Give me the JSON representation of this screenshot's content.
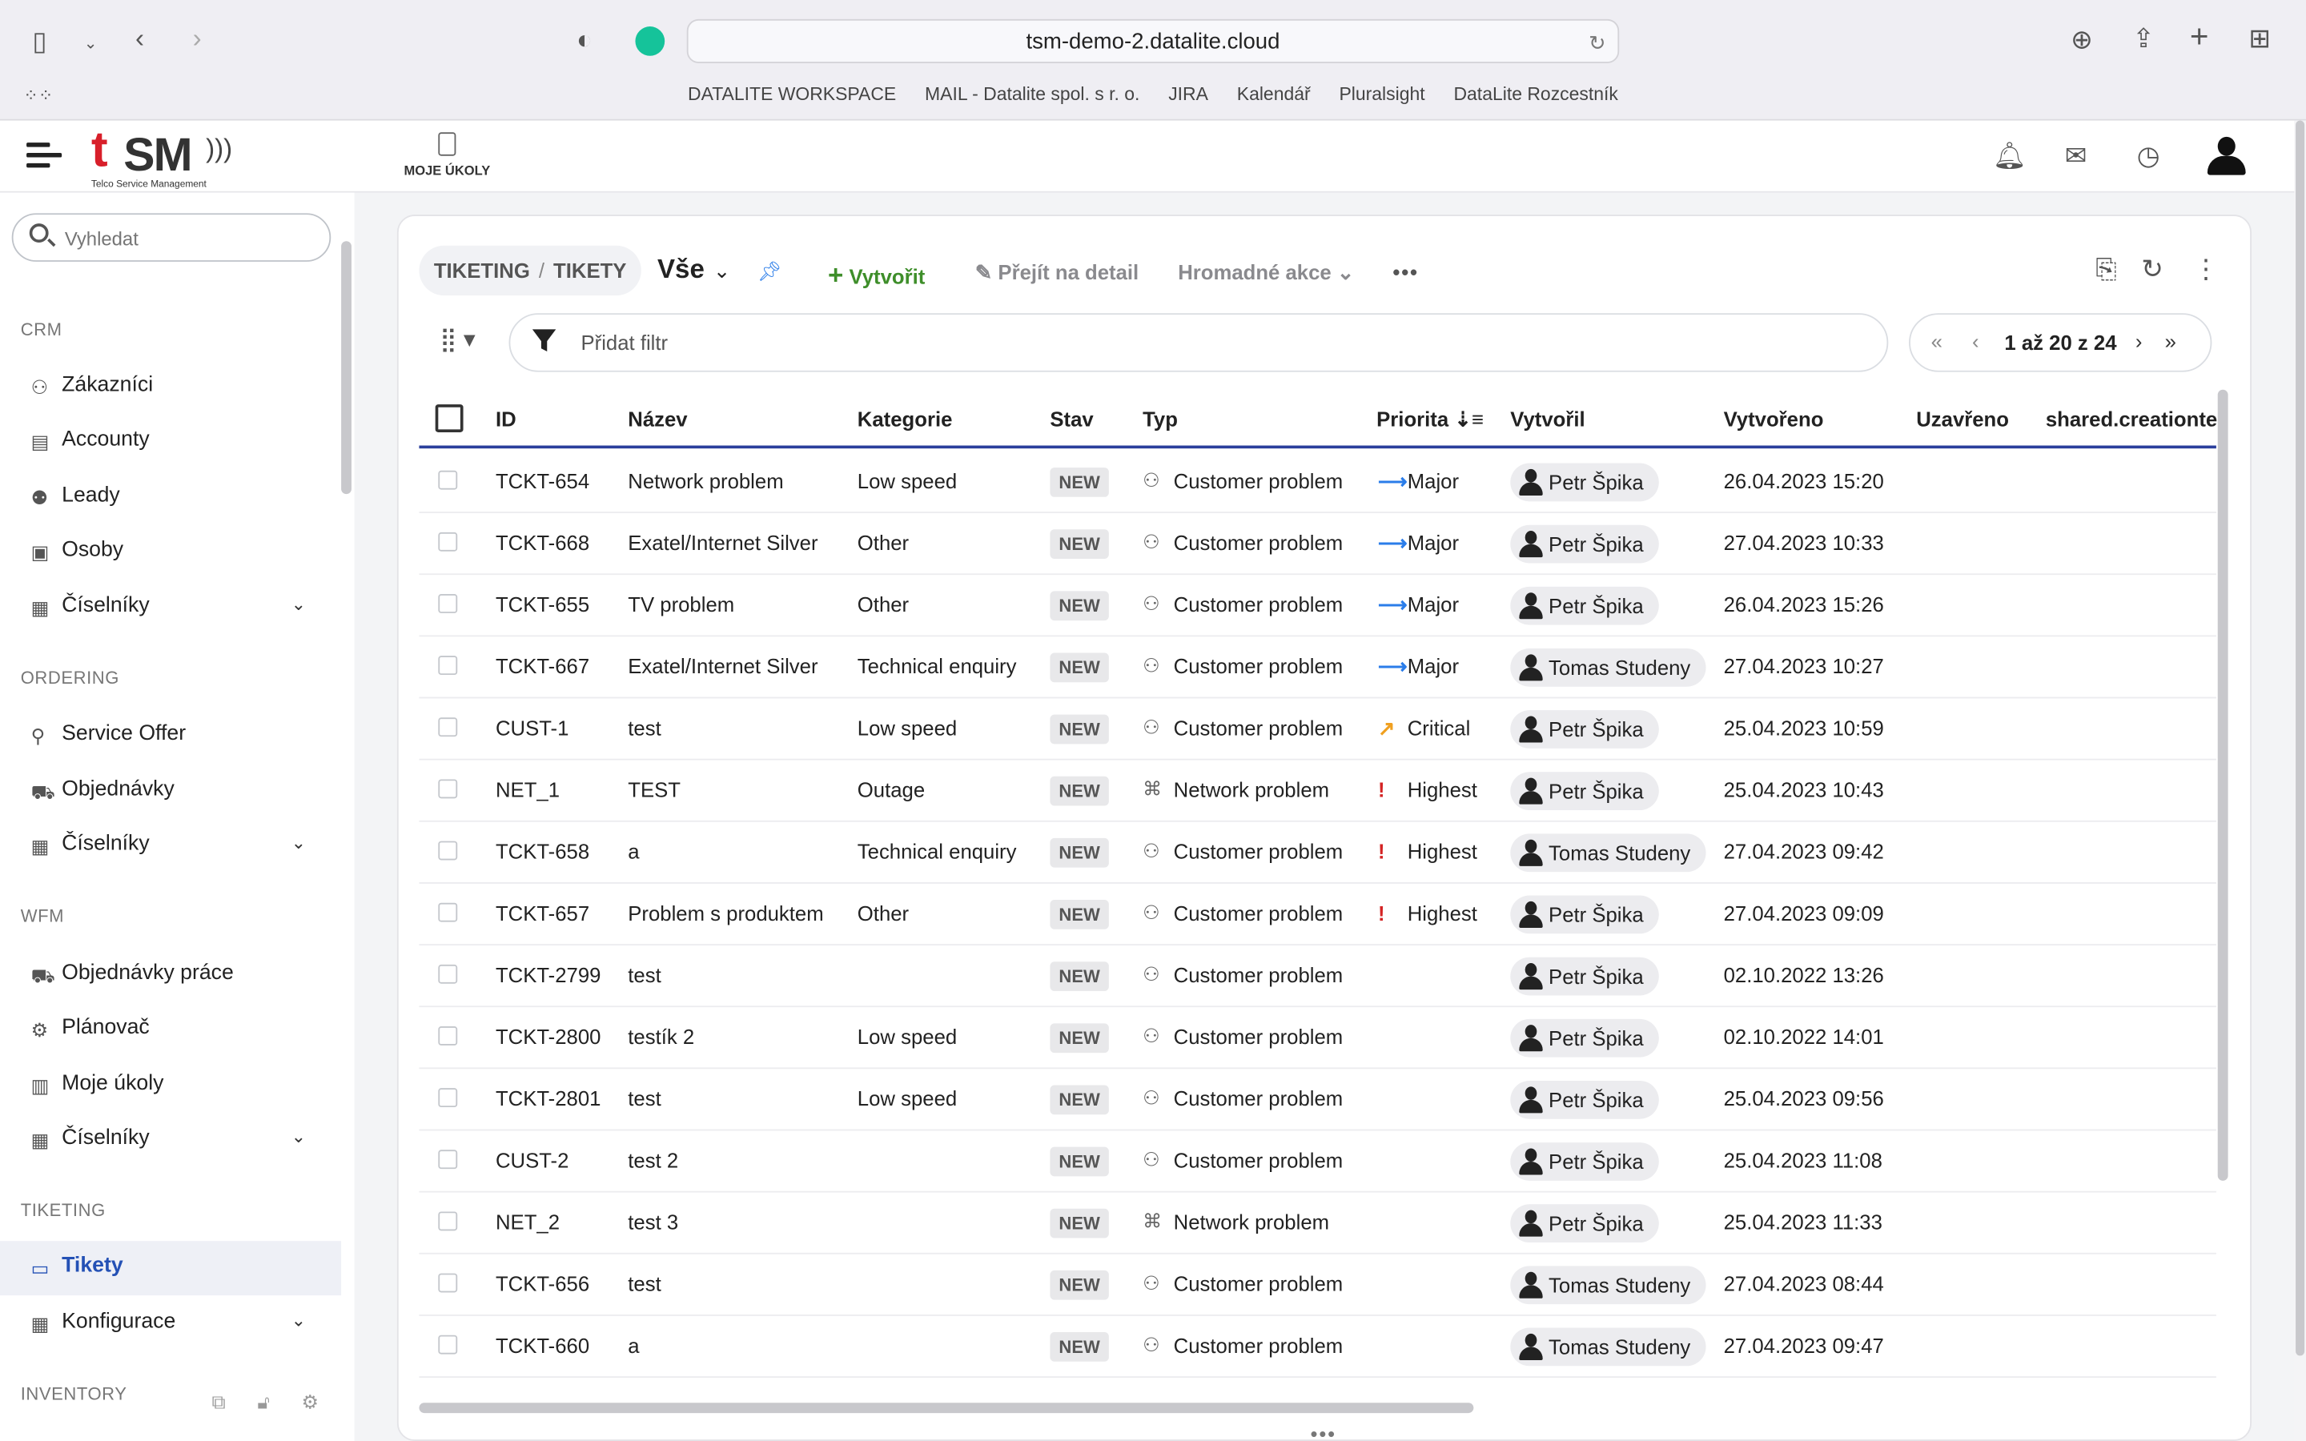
{
  "browser": {
    "url": "tsm-demo-2.datalite.cloud",
    "bookmarks": [
      "DATALITE WORKSPACE",
      "MAIL - Datalite spol. s r. o.",
      "JIRA",
      "Kalendář",
      "Pluralsight",
      "DataLite Rozcestník"
    ]
  },
  "header": {
    "logo_text": "tSM",
    "logo_sub": "Telco Service Management",
    "my_tasks": "MOJE ÚKOLY"
  },
  "sidebar": {
    "search_placeholder": "Vyhledat",
    "sections": [
      {
        "title": "CRM",
        "items": [
          {
            "label": "Zákazníci",
            "icon": "customers-icon"
          },
          {
            "label": "Accounty",
            "icon": "account-icon"
          },
          {
            "label": "Leady",
            "icon": "leads-icon"
          },
          {
            "label": "Osoby",
            "icon": "person-icon"
          },
          {
            "label": "Číselníky",
            "icon": "codelist-icon",
            "expandable": true
          }
        ]
      },
      {
        "title": "ORDERING",
        "items": [
          {
            "label": "Service Offer",
            "icon": "service-offer-icon"
          },
          {
            "label": "Objednávky",
            "icon": "cart-icon"
          },
          {
            "label": "Číselníky",
            "icon": "codelist-icon",
            "expandable": true
          }
        ]
      },
      {
        "title": "WFM",
        "items": [
          {
            "label": "Objednávky práce",
            "icon": "cart-icon"
          },
          {
            "label": "Plánovač",
            "icon": "planner-icon"
          },
          {
            "label": "Moje úkoly",
            "icon": "tasks-icon"
          },
          {
            "label": "Číselníky",
            "icon": "codelist-icon",
            "expandable": true
          }
        ]
      },
      {
        "title": "TIKETING",
        "items": [
          {
            "label": "Tikety",
            "icon": "ticket-icon",
            "active": true
          },
          {
            "label": "Konfigurace",
            "icon": "config-icon",
            "expandable": true
          }
        ]
      },
      {
        "title": "INVENTORY",
        "items": []
      }
    ]
  },
  "toolbar": {
    "crumb_1": "TIKETING",
    "crumb_2": "TIKETY",
    "view": "Vše",
    "create": "Vytvořit",
    "detail": "Přejít na detail",
    "bulk": "Hromadné akce",
    "filter_placeholder": "Přidat filtr",
    "pager": "1 až 20 z 24"
  },
  "table": {
    "columns": [
      "ID",
      "Název",
      "Kategorie",
      "Stav",
      "Typ",
      "Priorita",
      "Vytvořil",
      "Vytvořeno",
      "Uzavřeno",
      "shared.creationtes"
    ],
    "rows": [
      [
        "TCKT-654",
        "Network problem",
        "Low speed",
        "NEW",
        "Customer problem",
        "Major",
        "Petr Špika",
        "26.04.2023 15:20"
      ],
      [
        "TCKT-668",
        "Exatel/Internet Silver",
        "Other",
        "NEW",
        "Customer problem",
        "Major",
        "Petr Špika",
        "27.04.2023 10:33"
      ],
      [
        "TCKT-655",
        "TV problem",
        "Other",
        "NEW",
        "Customer problem",
        "Major",
        "Petr Špika",
        "26.04.2023 15:26"
      ],
      [
        "TCKT-667",
        "Exatel/Internet Silver",
        "Technical enquiry",
        "NEW",
        "Customer problem",
        "Major",
        "Tomas Studeny",
        "27.04.2023 10:27"
      ],
      [
        "CUST-1",
        "test",
        "Low speed",
        "NEW",
        "Customer problem",
        "Critical",
        "Petr Špika",
        "25.04.2023 10:59"
      ],
      [
        "NET_1",
        "TEST",
        "Outage",
        "NEW",
        "Network problem",
        "Highest",
        "Petr Špika",
        "25.04.2023 10:43"
      ],
      [
        "TCKT-658",
        "a",
        "Technical enquiry",
        "NEW",
        "Customer problem",
        "Highest",
        "Tomas Studeny",
        "27.04.2023 09:42"
      ],
      [
        "TCKT-657",
        "Problem s produktem",
        "Other",
        "NEW",
        "Customer problem",
        "Highest",
        "Petr Špika",
        "27.04.2023 09:09"
      ],
      [
        "TCKT-2799",
        "test",
        "",
        "NEW",
        "Customer problem",
        "",
        "Petr Špika",
        "02.10.2022 13:26"
      ],
      [
        "TCKT-2800",
        "testík 2",
        "Low speed",
        "NEW",
        "Customer problem",
        "",
        "Petr Špika",
        "02.10.2022 14:01"
      ],
      [
        "TCKT-2801",
        "test",
        "Low speed",
        "NEW",
        "Customer problem",
        "",
        "Petr Špika",
        "25.04.2023 09:56"
      ],
      [
        "CUST-2",
        "test 2",
        "",
        "NEW",
        "Customer problem",
        "",
        "Petr Špika",
        "25.04.2023 11:08"
      ],
      [
        "NET_2",
        "test 3",
        "",
        "NEW",
        "Network problem",
        "",
        "Petr Špika",
        "25.04.2023 11:33"
      ],
      [
        "TCKT-656",
        "test",
        "",
        "NEW",
        "Customer problem",
        "",
        "Tomas Studeny",
        "27.04.2023 08:44"
      ],
      [
        "TCKT-660",
        "a",
        "",
        "NEW",
        "Customer problem",
        "",
        "Tomas Studeny",
        "27.04.2023 09:47"
      ]
    ]
  },
  "colors": {
    "major": "#2b7de9",
    "critical": "#f0a020",
    "highest": "#d42424",
    "accent": "#2b3f9c",
    "create": "#3e8e2a"
  }
}
